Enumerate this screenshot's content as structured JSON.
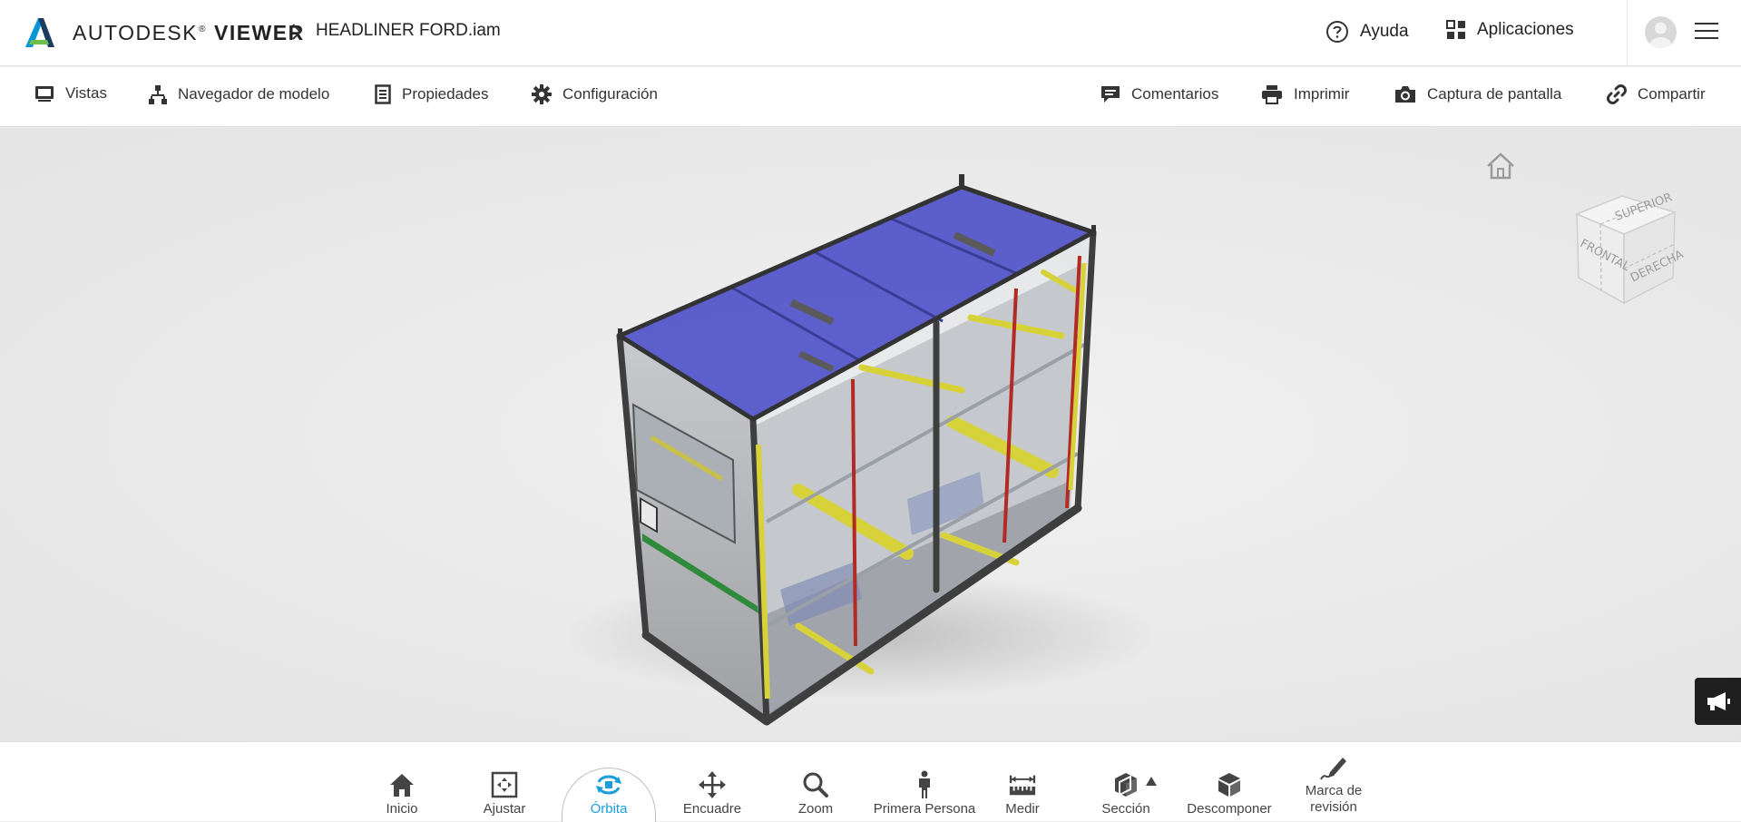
{
  "header": {
    "brand_prefix": "AUTODESK",
    "brand_suffix": "VIEWER",
    "file_name": "HEADLINER FORD.iam",
    "help_label": "Ayuda",
    "apps_label": "Aplicaciones",
    "icons": [
      "autodesk-logo",
      "chevron-right-icon",
      "help-icon",
      "apps-grid-icon",
      "avatar",
      "hamburger-menu-icon"
    ]
  },
  "toolbar": {
    "left": [
      {
        "label": "Vistas",
        "icon": "monitor-icon"
      },
      {
        "label": "Navegador de modelo",
        "icon": "hierarchy-icon"
      },
      {
        "label": "Propiedades",
        "icon": "document-icon"
      },
      {
        "label": "Configuración",
        "icon": "gear-icon"
      }
    ],
    "right": [
      {
        "label": "Comentarios",
        "icon": "comment-icon"
      },
      {
        "label": "Imprimir",
        "icon": "printer-icon"
      },
      {
        "label": "Captura de pantalla",
        "icon": "camera-icon"
      },
      {
        "label": "Compartir",
        "icon": "link-icon"
      }
    ]
  },
  "viewcube": {
    "top": "SUPERIOR",
    "front": "FRONTAL",
    "right": "DERECHA"
  },
  "bottom_nav": {
    "active": "Órbita",
    "items": [
      {
        "label": "Inicio",
        "icon": "home-icon"
      },
      {
        "label": "Ajustar",
        "icon": "fit-icon"
      },
      {
        "label": "Órbita",
        "icon": "orbit-icon"
      },
      {
        "label": "Encuadre",
        "icon": "pan-icon"
      },
      {
        "label": "Zoom",
        "icon": "zoom-icon"
      },
      {
        "label": "Primera Persona",
        "icon": "person-icon"
      },
      {
        "label": "Medir",
        "icon": "measure-icon"
      },
      {
        "label": "Sección",
        "icon": "section-icon"
      },
      {
        "label": "Descomponer",
        "icon": "explode-icon"
      },
      {
        "label": "Marca de revisión",
        "icon": "markup-icon"
      }
    ]
  },
  "colors": {
    "accent": "#1a9fdc",
    "roof_panel": "#4c4fc8",
    "rails": "#d8d23a",
    "frame": "#3e3e3e",
    "red_bars": "#b22a24"
  }
}
